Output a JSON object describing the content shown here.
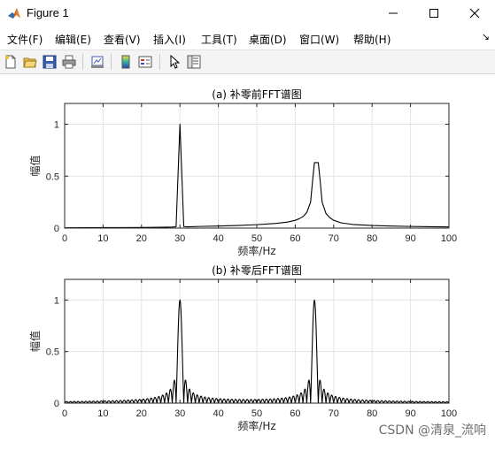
{
  "window": {
    "title": "Figure 1",
    "controls": {
      "minimize": "minimize-icon",
      "maximize": "maximize-icon",
      "close": "close-icon"
    }
  },
  "menu": {
    "items": [
      "文件(F)",
      "编辑(E)",
      "查看(V)",
      "插入(I)",
      "工具(T)",
      "桌面(D)",
      "窗口(W)",
      "帮助(H)"
    ],
    "overflow_icon": "dock-arrow-icon"
  },
  "toolbar": {
    "icons": [
      "new-figure-icon",
      "open-file-icon",
      "save-icon",
      "print-icon",
      "link-plot-icon",
      "colorbar-icon",
      "legend-icon",
      "edit-plot-icon",
      "property-inspector-icon"
    ]
  },
  "chart_data": [
    {
      "type": "line",
      "title": "(a) 补零前FFT谱图",
      "xlabel": "频率/Hz",
      "ylabel": "幅值",
      "xlim": [
        0,
        100
      ],
      "ylim": [
        0,
        1.2
      ],
      "xticks": [
        "0",
        "10",
        "20",
        "30",
        "40",
        "50",
        "60",
        "70",
        "80",
        "90",
        "100"
      ],
      "yticks": [
        "0",
        "0.5",
        "1"
      ],
      "grid": true,
      "color": "#000000",
      "x": [
        0,
        5,
        10,
        15,
        20,
        25,
        28,
        29,
        30,
        31,
        32,
        35,
        40,
        45,
        50,
        55,
        58,
        60,
        61,
        62,
        63,
        64,
        64.5,
        65,
        65.5,
        66,
        66.5,
        67,
        68,
        69,
        70,
        72,
        75,
        80,
        85,
        90,
        95,
        100
      ],
      "y": [
        0.003,
        0.004,
        0.005,
        0.005,
        0.006,
        0.008,
        0.01,
        0.012,
        1.0,
        0.015,
        0.012,
        0.016,
        0.02,
        0.025,
        0.033,
        0.045,
        0.058,
        0.075,
        0.09,
        0.11,
        0.15,
        0.25,
        0.45,
        0.63,
        0.63,
        0.63,
        0.45,
        0.25,
        0.14,
        0.1,
        0.075,
        0.05,
        0.035,
        0.025,
        0.02,
        0.016,
        0.013,
        0.011
      ]
    },
    {
      "type": "line",
      "title": "(b) 补零后FFT谱图",
      "xlabel": "频率/Hz",
      "ylabel": "幅值",
      "xlim": [
        0,
        100
      ],
      "ylim": [
        0,
        1.2
      ],
      "xticks": [
        "0",
        "10",
        "20",
        "30",
        "40",
        "50",
        "60",
        "70",
        "80",
        "90",
        "100"
      ],
      "yticks": [
        "0",
        "0.5",
        "1"
      ],
      "grid": true,
      "color": "#000000",
      "peaks": [
        30,
        65
      ],
      "peak_value": 1.0,
      "sidelobe_spacing": 0.5
    }
  ],
  "watermark": "CSDN @清泉_流响"
}
